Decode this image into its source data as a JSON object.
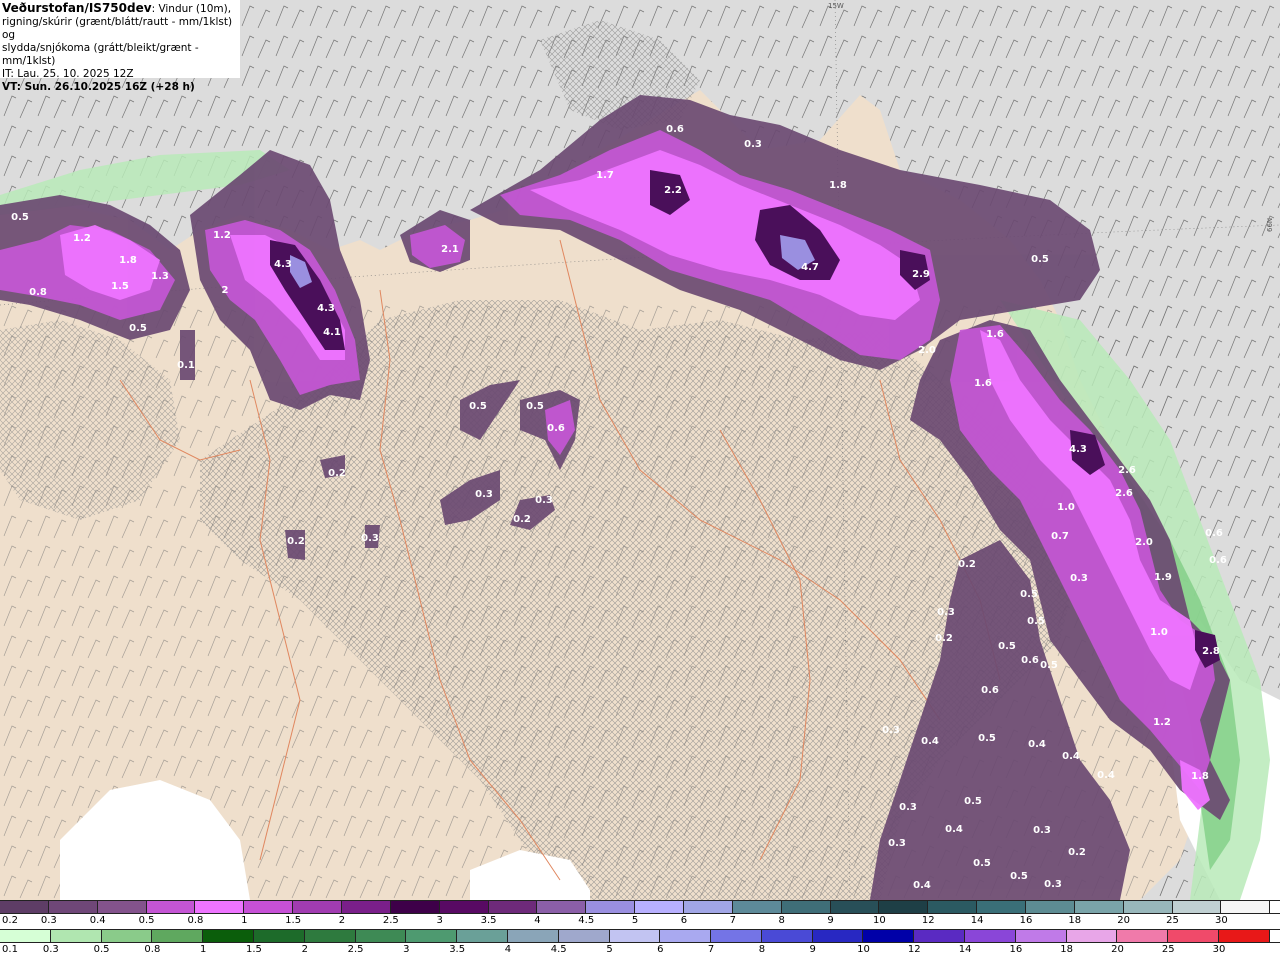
{
  "title": {
    "source": "Veðurstofan/IS750dev",
    "description_1": ": Vindur (10m),",
    "description_2": "rigning/skúrir (grænt/blátt/rautt - mm/1klst) og",
    "description_3": "slydda/snjókoma (grátt/bleikt/grænt - mm/1klst)",
    "issue_time": "IT: Lau. 25. 10. 2025 12Z",
    "valid_time": "VT: Sun. 26.10.2025 16Z (+28 h)"
  },
  "graticule": {
    "top_label": "15W",
    "right_label": "66N"
  },
  "colors": {
    "land": "#efdfcc",
    "sea": "#dcdcdc",
    "snow_light": "#6b4a72",
    "snow_mid": "#a455b0",
    "snow_high": "#d96ee8",
    "snow_core": "#4a0f5a",
    "rain_light": "#b8eab8",
    "rain_mid": "#7ccc82"
  },
  "precip_labels": [
    "0.5",
    "1.2",
    "1.8",
    "1.3",
    "0.8",
    "1.5",
    "0.5",
    "1.2",
    "4.3",
    "4.3",
    "4.1",
    "2",
    "0.1",
    "0.6",
    "0.3",
    "1.7",
    "2.2",
    "1.8",
    "4.7",
    "2.1",
    "2.9",
    "0.5",
    "1.6",
    "2.0",
    "1.6",
    "0.5",
    "0.5",
    "0.6",
    "0.3",
    "0.2",
    "0.3",
    "0.2",
    "0.3",
    "0.2",
    "4.3",
    "2.6",
    "2.6",
    "1.0",
    "0.7",
    "2.0",
    "0.6",
    "0.6",
    "0.3",
    "1.9",
    "1.0",
    "2.8",
    "1.2",
    "1.8",
    "0.2",
    "0.3",
    "0.2",
    "0.5",
    "0.5",
    "0.5",
    "0.6",
    "0.5",
    "0.6",
    "0.4",
    "0.5",
    "0.4",
    "0.4",
    "0.3",
    "0.4",
    "0.3",
    "0.5",
    "0.4",
    "0.3",
    "0.3",
    "0.5",
    "0.4",
    "0.2",
    "0.5",
    "0.3"
  ],
  "legend_snow": {
    "labels": [
      "0.2",
      "0.3",
      "0.4",
      "0.5",
      "0.8",
      "1",
      "1.5",
      "2",
      "2.5",
      "3",
      "3.5",
      "4",
      "4.5",
      "5",
      "6",
      "7",
      "8",
      "9",
      "10",
      "12",
      "14",
      "16",
      "18",
      "20",
      "25",
      "30"
    ],
    "colors": [
      "#5e3d66",
      "#6f4778",
      "#83538c",
      "#c455d4",
      "#ee74ff",
      "#c650d6",
      "#a13cb1",
      "#7a1f8a",
      "#3e0049",
      "#580a63",
      "#6e2a7a",
      "#8b5fa8",
      "#9a8fe0",
      "#b8b0ff",
      "#a1a6e6",
      "#5d8a99",
      "#3f6e78",
      "#284f58",
      "#1e3f46",
      "#2b5a62",
      "#3a6f78",
      "#5d8c93",
      "#7aa4a9",
      "#98b7bb",
      "#c0d0d2",
      "#f6f6f6"
    ]
  },
  "legend_rain": {
    "labels": [
      "0.1",
      "0.3",
      "0.5",
      "0.8",
      "1",
      "1.5",
      "2",
      "2.5",
      "3",
      "3.5",
      "4",
      "4.5",
      "5",
      "6",
      "7",
      "8",
      "9",
      "10",
      "12",
      "14",
      "16",
      "18",
      "20",
      "25",
      "30"
    ],
    "colors": [
      "#d6ffd6",
      "#b0e6b0",
      "#8acb8a",
      "#5fa85f",
      "#0b5e0b",
      "#1d6b2a",
      "#2e7a3e",
      "#3e8a55",
      "#4e9a70",
      "#6aa098",
      "#8aa5b8",
      "#9fa8cc",
      "#c2c4f2",
      "#a9a9f0",
      "#7474e6",
      "#4a4ad6",
      "#2828c2",
      "#0000a8",
      "#5a2ac2",
      "#8a46d8",
      "#c07ae8",
      "#e8a6e8",
      "#f07aaa",
      "#f04a6a",
      "#e81818"
    ]
  }
}
